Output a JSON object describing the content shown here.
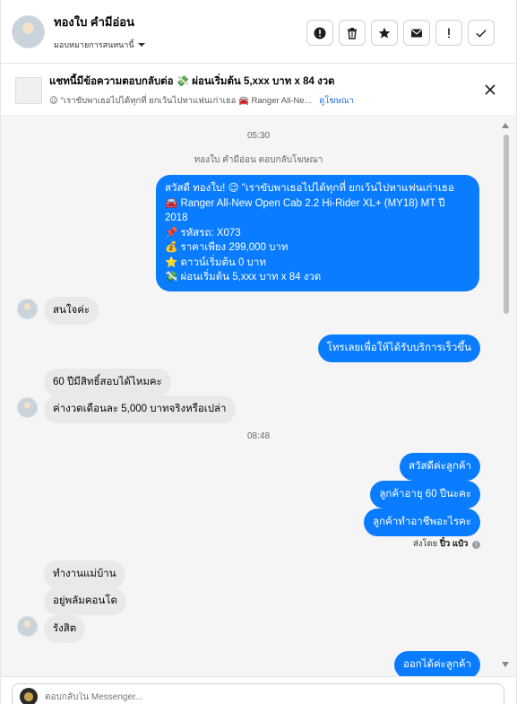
{
  "header": {
    "contact_name": "ทองใบ คำมีอ่อน",
    "assign_label": "มอบหมายการสนทนานี้",
    "toolbar_icons": [
      "alert-circle-icon",
      "trash-icon",
      "star-icon",
      "envelope-icon",
      "exclamation-icon",
      "check-icon"
    ]
  },
  "ad": {
    "title": "แชทนี้มีข้อความตอบกลับต่อ 💸 ผ่อนเริ่มต้น 5,xxx บาท x 84 งวด",
    "line": "😉 \"เราขับพาเธอไปได้ทุกที่ ยกเว้นไปหาแฟนเก่าเธอ 🚘 Ranger All-Ne...",
    "link": "ดูโฆษณา"
  },
  "chat": {
    "time1": "05:30",
    "system_note": "ทองใบ คำมีอ่อน ตอบกลับโฆษณา",
    "msg_ad_reply": "สวัสดี ทองใบ! 😉 \"เราขับพาเธอไปได้ทุกที่ ยกเว้นไปหาแฟนเก่าเธอ\n🚘 Ranger All-New Open Cab 2.2 Hi-Rider XL+ (MY18) MT ปี 2018\n📌 รหัสรถ: X073\n💰 ราคาเพียง 299,000 บาท\n⭐ ดาวน์เริ่มต้น 0 บาท\n💸 ผ่อนเริ่มต้น 5,xxx บาท x 84 งวด",
    "msg_in_1": "สนใจค่ะ",
    "msg_out_1": "โทรเลยเพื่อให้ได้รับบริการเร็วขึ้น",
    "msg_in_2": "60 ปีมีสิทธิ์สอบได้ไหมคะ",
    "msg_in_3": "ค่างวดเดือนละ 5,000 บาทจริงหรือเปล่า",
    "time2": "08:48",
    "msg_out_2": "สวัสดีค่ะลูกค้า",
    "msg_out_3": "ลูกค้าอายุ 60 ปีนะคะ",
    "msg_out_4": "ลูกค้าทำอาชีพอะไรคะ",
    "sent_by_prefix": "ส่งโดย",
    "sent_by_name": "ปิ๋ว แป๋ว",
    "msg_in_4": "ทำงานแม่บ้าน",
    "msg_in_5": "อยู่พลัมคอนโด",
    "msg_in_6": "รังสิต",
    "msg_out_5": "ออกได้ค่ะลูกค้า"
  },
  "composer": {
    "placeholder": "ตอบกลับใน Messenger..."
  },
  "colors": {
    "outgoing_bubble": "#0a7cff",
    "incoming_bubble": "#e9e9eb",
    "chat_background": "#f5f5f5"
  }
}
